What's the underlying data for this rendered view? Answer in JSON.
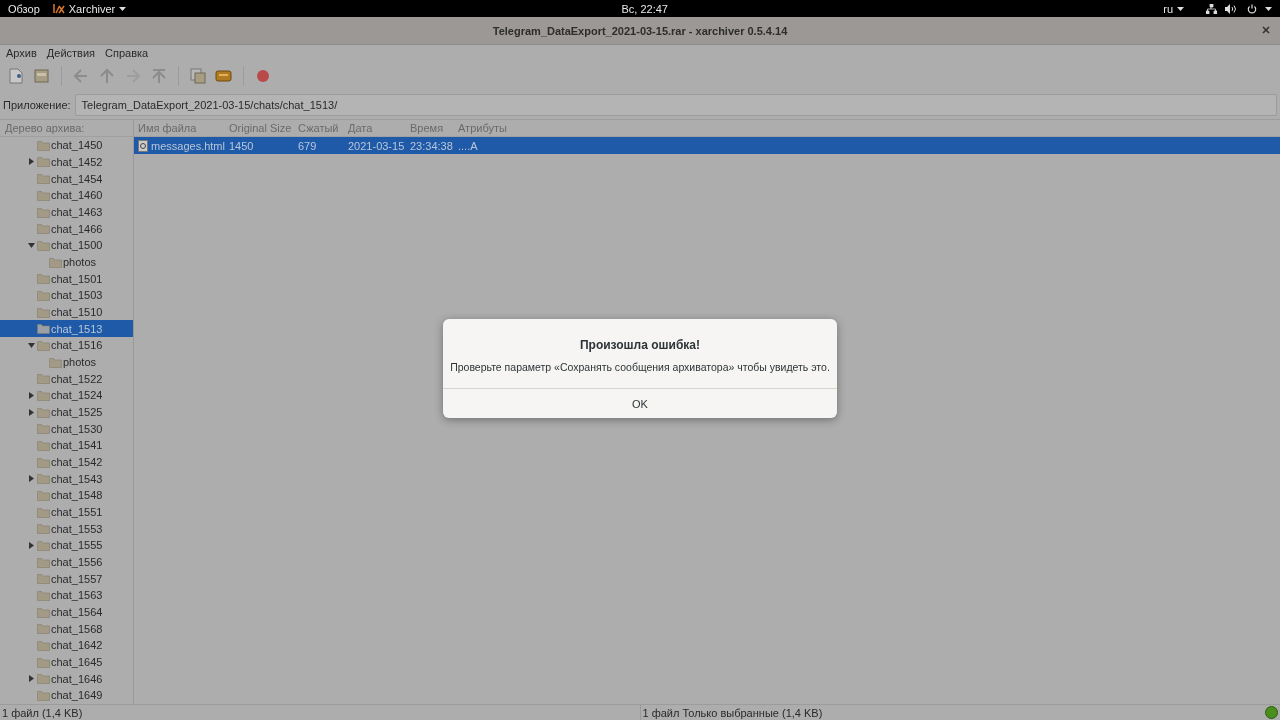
{
  "top_bar": {
    "activities": "Обзор",
    "app_menu": "Xarchiver",
    "clock": "Вс, 22:47",
    "language": "ru"
  },
  "window": {
    "title": "Telegram_DataExport_2021-03-15.rar - xarchiver 0.5.4.14"
  },
  "menu": [
    "Архив",
    "Действия",
    "Справка"
  ],
  "location": {
    "label": "Приложение:",
    "value": "Telegram_DataExport_2021-03-15/chats/chat_1513/"
  },
  "tree": {
    "title": "Дерево архива:",
    "items": [
      {
        "label": "chat_1450",
        "selected": false
      },
      {
        "label": "chat_1452",
        "expanded": false,
        "selected": false
      },
      {
        "label": "chat_1454",
        "selected": false
      },
      {
        "label": "chat_1460",
        "selected": false
      },
      {
        "label": "chat_1463",
        "selected": false
      },
      {
        "label": "chat_1466",
        "selected": false
      },
      {
        "label": "chat_1500",
        "expanded": true,
        "selected": false,
        "children": [
          {
            "label": "photos",
            "selected": false
          }
        ]
      },
      {
        "label": "chat_1501",
        "selected": false
      },
      {
        "label": "chat_1503",
        "selected": false
      },
      {
        "label": "chat_1510",
        "selected": false
      },
      {
        "label": "chat_1513",
        "selected": true
      },
      {
        "label": "chat_1516",
        "expanded": true,
        "selected": false,
        "children": [
          {
            "label": "photos",
            "selected": false
          }
        ]
      },
      {
        "label": "chat_1522",
        "selected": false
      },
      {
        "label": "chat_1524",
        "expanded": false,
        "selected": false
      },
      {
        "label": "chat_1525",
        "expanded": false,
        "selected": false
      },
      {
        "label": "chat_1530",
        "selected": false
      },
      {
        "label": "chat_1541",
        "selected": false
      },
      {
        "label": "chat_1542",
        "selected": false
      },
      {
        "label": "chat_1543",
        "expanded": false,
        "selected": false
      },
      {
        "label": "chat_1548",
        "selected": false
      },
      {
        "label": "chat_1551",
        "selected": false
      },
      {
        "label": "chat_1553",
        "selected": false
      },
      {
        "label": "chat_1555",
        "expanded": false,
        "selected": false
      },
      {
        "label": "chat_1556",
        "selected": false
      },
      {
        "label": "chat_1557",
        "selected": false
      },
      {
        "label": "chat_1563",
        "selected": false
      },
      {
        "label": "chat_1564",
        "selected": false
      },
      {
        "label": "chat_1568",
        "selected": false
      },
      {
        "label": "chat_1642",
        "selected": false
      },
      {
        "label": "chat_1645",
        "selected": false
      },
      {
        "label": "chat_1646",
        "expanded": false,
        "selected": false
      },
      {
        "label": "chat_1649",
        "selected": false
      }
    ]
  },
  "table": {
    "columns": [
      "Имя файла",
      "Original Size",
      "Сжатый",
      "Дата",
      "Время",
      "Атрибуты"
    ],
    "rows": [
      {
        "cells": [
          "messages.html",
          "1450",
          "679",
          "2021-03-15",
          "23:34:38",
          "....A"
        ],
        "selected": true
      }
    ]
  },
  "dialog": {
    "title": "Произошла ошибка!",
    "message": "Проверьте параметр «Сохранять сообщения архиватора» чтобы увидеть это.",
    "button": "OK"
  },
  "status_bar": {
    "left": "1 файл  (1,4 KB)",
    "right": "1 файл Только выбранные (1,4 KB)"
  }
}
